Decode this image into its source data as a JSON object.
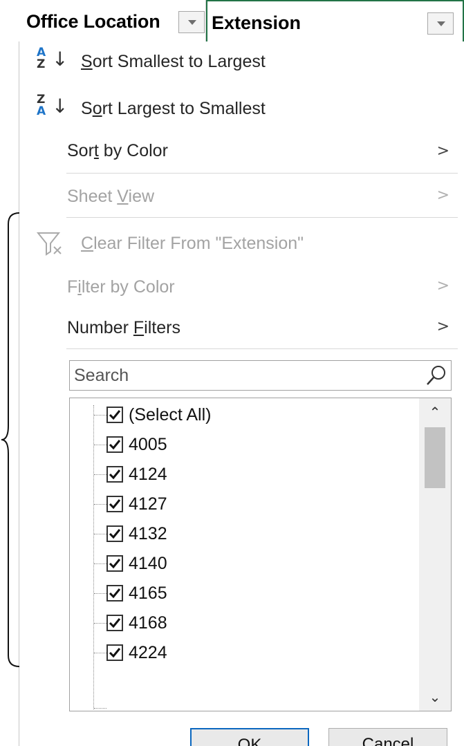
{
  "headers": {
    "office_location": "Office Location",
    "extension": "Extension"
  },
  "menu": {
    "sort_asc": {
      "pre": "",
      "ul": "S",
      "post": "ort Smallest to Largest",
      "icon_top": "A",
      "icon_bottom": "Z"
    },
    "sort_desc": {
      "pre": "S",
      "ul": "o",
      "post": "rt Largest to Smallest",
      "icon_top": "Z",
      "icon_bottom": "A"
    },
    "sort_by_color": {
      "pre": "Sor",
      "ul": "t",
      "post": " by Color"
    },
    "sheet_view": {
      "pre": "Sheet ",
      "ul": "V",
      "post": "iew"
    },
    "clear_filter": {
      "pre": "",
      "ul": "C",
      "post": "lear Filter From \"Extension\""
    },
    "filter_by_color": {
      "pre": "F",
      "ul": "i",
      "post": "lter by Color"
    },
    "number_filters": {
      "pre": "Number ",
      "ul": "F",
      "post": "ilters"
    },
    "chevron": ">"
  },
  "search": {
    "placeholder": "Search"
  },
  "list": {
    "items": [
      {
        "label": "(Select All)",
        "checked": true
      },
      {
        "label": "4005",
        "checked": true
      },
      {
        "label": "4124",
        "checked": true
      },
      {
        "label": "4127",
        "checked": true
      },
      {
        "label": "4132",
        "checked": true
      },
      {
        "label": "4140",
        "checked": true
      },
      {
        "label": "4165",
        "checked": true
      },
      {
        "label": "4168",
        "checked": true
      },
      {
        "label": "4224",
        "checked": true
      }
    ],
    "scroll_up": "^",
    "scroll_down": "v"
  },
  "buttons": {
    "ok": "OK",
    "cancel": "Cancel"
  },
  "colors": {
    "excel_green": "#217346",
    "ok_border": "#0b67bf",
    "sort_icon_blue": "#1e74c8",
    "disabled_text": "#a3a3a3"
  },
  "icons": {
    "sort_asc": "sort-ascending-icon",
    "sort_desc": "sort-descending-icon",
    "clear_filter": "clear-filter-icon",
    "search": "search-icon",
    "dropdown": "dropdown-arrow-icon",
    "checkbox": "checkmark-icon"
  }
}
